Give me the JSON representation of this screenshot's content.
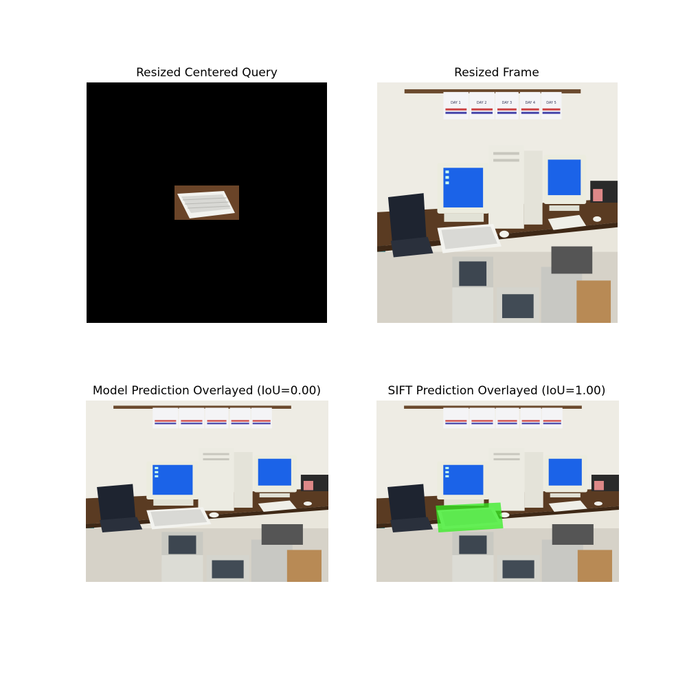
{
  "panels": [
    {
      "title": "Resized Centered Query"
    },
    {
      "title": "Resized Frame"
    },
    {
      "title": "Model Prediction Overlayed (IoU=0.00)"
    },
    {
      "title": "SIFT Prediction Overlayed (IoU=1.00)"
    }
  ],
  "poster": {
    "days": [
      "DAY 1",
      "DAY 2",
      "DAY 3",
      "DAY 4",
      "DAY 5"
    ]
  },
  "colors": {
    "query_background": "#000000",
    "sift_overlay": "#33ee22",
    "wall": "#e9e6dc",
    "desk": "#5a3b22",
    "screen": "#1b63e8"
  }
}
